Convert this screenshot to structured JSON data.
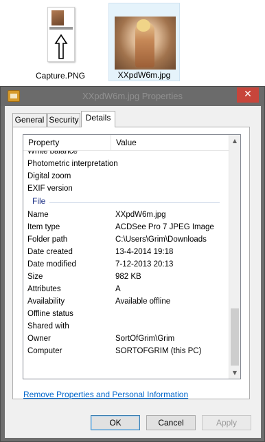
{
  "desktop": {
    "items": [
      {
        "label": "Capture.PNG"
      },
      {
        "label": "XXpdW6m.jpg"
      }
    ]
  },
  "dialog": {
    "title": "XXpdW6m.jpg Properties",
    "close_glyph": "✕",
    "tabs": [
      {
        "label": "General"
      },
      {
        "label": "Security"
      },
      {
        "label": "Details"
      }
    ],
    "active_tab": "Details",
    "columns": {
      "property": "Property",
      "value": "Value"
    },
    "rows_top": [
      {
        "property": "White balance",
        "value": ""
      },
      {
        "property": "Photometric interpretation",
        "value": ""
      },
      {
        "property": "Digital zoom",
        "value": ""
      },
      {
        "property": "EXIF version",
        "value": ""
      }
    ],
    "group_file": "File",
    "rows_file": [
      {
        "property": "Name",
        "value": "XXpdW6m.jpg"
      },
      {
        "property": "Item type",
        "value": "ACDSee Pro 7 JPEG Image"
      },
      {
        "property": "Folder path",
        "value": "C:\\Users\\Grim\\Downloads"
      },
      {
        "property": "Date created",
        "value": "13-4-2014 19:18"
      },
      {
        "property": "Date modified",
        "value": "7-12-2013 20:13"
      },
      {
        "property": "Size",
        "value": "982 KB"
      },
      {
        "property": "Attributes",
        "value": "A"
      },
      {
        "property": "Availability",
        "value": "Available offline"
      },
      {
        "property": "Offline status",
        "value": ""
      },
      {
        "property": "Shared with",
        "value": ""
      },
      {
        "property": "Owner",
        "value": "SortOfGrim\\Grim"
      },
      {
        "property": "Computer",
        "value": "SORTOFGRIM (this PC)"
      }
    ],
    "remove_link": "Remove Properties and Personal Information",
    "buttons": {
      "ok": "OK",
      "cancel": "Cancel",
      "apply": "Apply"
    },
    "colors": {
      "link": "#0066cc",
      "group_header": "#1e3287",
      "close_button": "#c7453b"
    }
  }
}
